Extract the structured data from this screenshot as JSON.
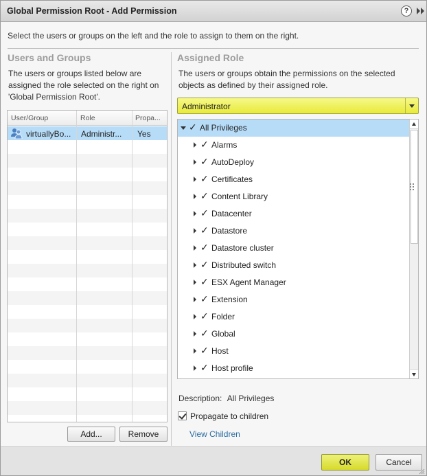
{
  "window": {
    "title": "Global Permission Root - Add Permission",
    "help_label": "?"
  },
  "intro_text": "Select the users or groups on the left and the role to assign to them on the right.",
  "users_and_groups": {
    "title": "Users and Groups",
    "description_line1": "The users or groups listed below are",
    "description_line2": "assigned the role selected on the right on",
    "description_line3": "'Global Permission Root'.",
    "columns": [
      "User/Group",
      "Role",
      "Propa..."
    ],
    "rows": [
      {
        "user": "virtuallyBo...",
        "role": "Administr...",
        "propagate": "Yes"
      }
    ],
    "add_label": "Add...",
    "remove_label": "Remove"
  },
  "assigned_role": {
    "title": "Assigned Role",
    "description_line1": "The users or groups obtain the permissions on the selected",
    "description_line2": "objects as defined by their assigned role.",
    "selected_role": "Administrator",
    "privileges": {
      "root": "All Privileges",
      "children": [
        "Alarms",
        "AutoDeploy",
        "Certificates",
        "Content Library",
        "Datacenter",
        "Datastore",
        "Datastore cluster",
        "Distributed switch",
        "ESX Agent Manager",
        "Extension",
        "Folder",
        "Global",
        "Host",
        "Host profile"
      ]
    },
    "description_label": "Description:",
    "description_value": "All Privileges",
    "propagate_label": "Propagate to children",
    "propagate_checked": true,
    "view_children_label": "View Children"
  },
  "footer": {
    "ok_label": "OK",
    "cancel_label": "Cancel"
  },
  "colors": {
    "accent_yellow": "#e8ea3a",
    "selection_blue": "#b7dcf8",
    "link_blue": "#2b6da3"
  }
}
